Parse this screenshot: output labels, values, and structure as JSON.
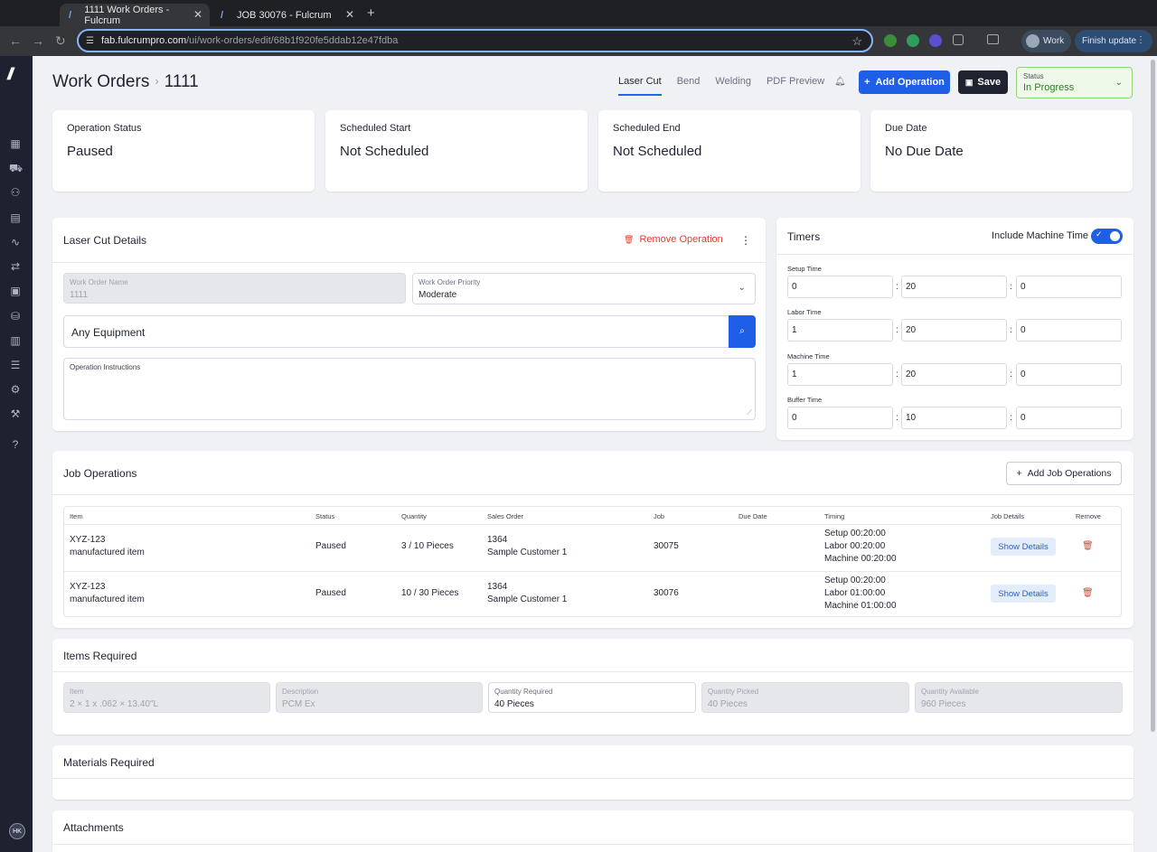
{
  "browser": {
    "tabs": [
      {
        "title": "1111 Work Orders - Fulcrum",
        "active": true
      },
      {
        "title": "JOB 30076 - Fulcrum",
        "active": false
      }
    ],
    "url_host": "fab.fulcrumpro.com",
    "url_path": "/ui/work-orders/edit/68b1f920fe5ddab12e47fdba",
    "profile_label": "Work",
    "finish_update_label": "Finish update"
  },
  "sidebar": {
    "logo": "//",
    "icons": [
      "grid-icon",
      "cart-icon",
      "people-icon",
      "calendar-icon",
      "activity-icon",
      "transfer-icon",
      "calculator-icon",
      "inventory-icon",
      "chart-icon",
      "list-icon",
      "settings-icon",
      "wrench-icon",
      "help-icon"
    ],
    "avatar": "HK"
  },
  "header": {
    "breadcrumb_root": "Work Orders",
    "breadcrumb_current": "1111",
    "tabs": [
      "Laser Cut",
      "Bend",
      "Welding",
      "PDF Preview"
    ],
    "add_operation_label": "Add Operation",
    "save_label": "Save",
    "status_label": "Status",
    "status_value": "In Progress"
  },
  "stats": [
    {
      "title": "Operation Status",
      "value": "Paused"
    },
    {
      "title": "Scheduled Start",
      "value": "Not Scheduled"
    },
    {
      "title": "Scheduled End",
      "value": "Not Scheduled"
    },
    {
      "title": "Due Date",
      "value": "No Due Date"
    }
  ],
  "details": {
    "title": "Laser Cut Details",
    "remove_label": "Remove Operation",
    "work_order_name_label": "Work Order Name",
    "work_order_name_value": "1111",
    "priority_label": "Work Order Priority",
    "priority_value": "Moderate",
    "equipment_value": "Any Equipment",
    "instructions_label": "Operation Instructions"
  },
  "timers": {
    "title": "Timers",
    "include_machine_label": "Include Machine Time",
    "include_machine_on": true,
    "rows": [
      {
        "label": "Setup Time",
        "h": "0",
        "m": "20",
        "s": "0"
      },
      {
        "label": "Labor Time",
        "h": "1",
        "m": "20",
        "s": "0"
      },
      {
        "label": "Machine Time",
        "h": "1",
        "m": "20",
        "s": "0"
      },
      {
        "label": "Buffer Time",
        "h": "0",
        "m": "10",
        "s": "0"
      }
    ]
  },
  "job_operations": {
    "title": "Job Operations",
    "add_label": "Add Job Operations",
    "columns": [
      "Item",
      "Status",
      "Quantity",
      "Sales Order",
      "Job",
      "Due Date",
      "Timing",
      "Job Details",
      "Remove"
    ],
    "rows": [
      {
        "item": "XYZ-123",
        "item_desc": "manufactured item",
        "status": "Paused",
        "quantity": "3 / 10 Pieces",
        "so": "1364",
        "customer": "Sample Customer 1",
        "job": "30075",
        "due": "",
        "setup": "Setup 00:20:00",
        "labor": "Labor 00:20:00",
        "machine": "Machine 00:20:00",
        "details_label": "Show Details"
      },
      {
        "item": "XYZ-123",
        "item_desc": "manufactured item",
        "status": "Paused",
        "quantity": "10 / 30 Pieces",
        "so": "1364",
        "customer": "Sample Customer 1",
        "job": "30076",
        "due": "",
        "setup": "Setup 00:20:00",
        "labor": "Labor 01:00:00",
        "machine": "Machine 01:00:00",
        "details_label": "Show Details"
      }
    ]
  },
  "items_required": {
    "title": "Items Required",
    "fields": [
      {
        "label": "Item",
        "value": "2 × 1 x .062 × 13.40\"L"
      },
      {
        "label": "Description",
        "value": "PCM Ex"
      },
      {
        "label": "Quantity Required",
        "value": "40 Pieces"
      },
      {
        "label": "Quantity Picked",
        "value": "40 Pieces"
      },
      {
        "label": "Quantity Available",
        "value": "960 Pieces"
      }
    ]
  },
  "materials_required": {
    "title": "Materials Required"
  },
  "attachments": {
    "title": "Attachments"
  }
}
